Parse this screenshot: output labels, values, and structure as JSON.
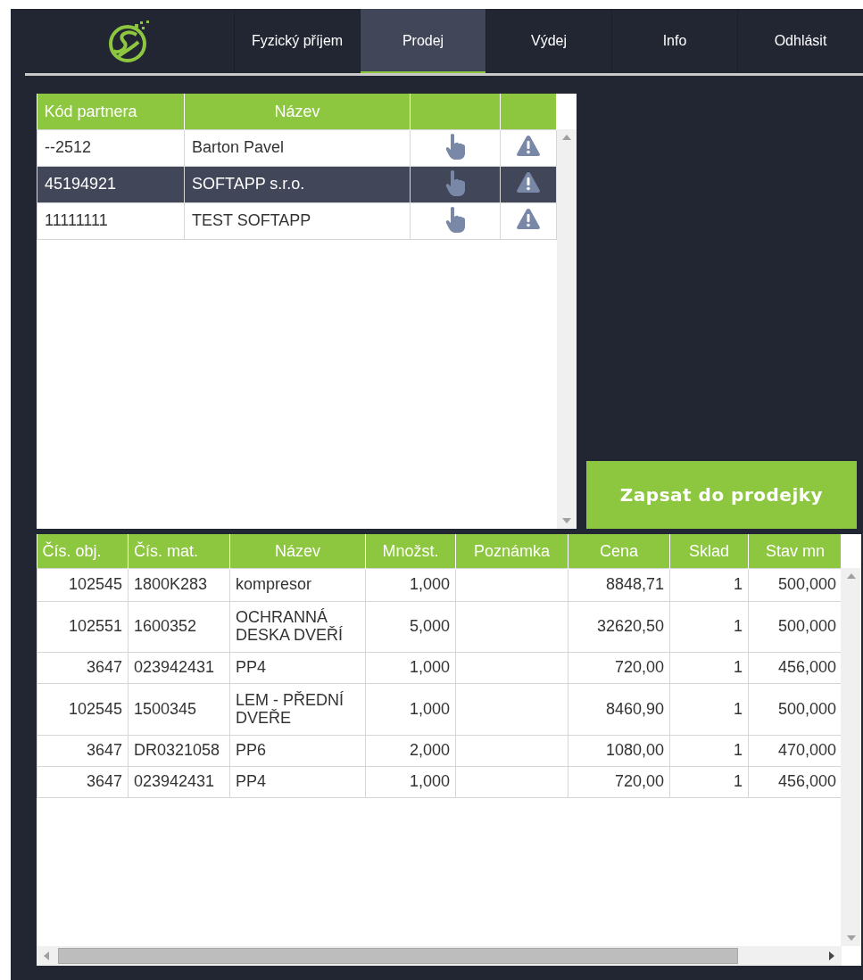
{
  "nav": {
    "tabs": [
      {
        "label": "Fyzický příjem",
        "selected": false
      },
      {
        "label": "Prodej",
        "selected": true
      },
      {
        "label": "Výdej",
        "selected": false
      },
      {
        "label": "Info",
        "selected": false
      },
      {
        "label": "Odhlásit",
        "selected": false
      }
    ]
  },
  "partners": {
    "columns": [
      "Kód partnera",
      "Název"
    ],
    "rows": [
      {
        "code": "--2512",
        "name": "Barton Pavel",
        "selected": false
      },
      {
        "code": "45194921",
        "name": "SOFTAPP s.r.o.",
        "selected": true
      },
      {
        "code": "11111111",
        "name": "TEST SOFTAPP",
        "selected": false
      }
    ]
  },
  "write_button": "Zapsat do prodejky",
  "items": {
    "columns": [
      "Čís. obj.",
      "Čís. mat.",
      "Název",
      "Množst.",
      "Poznámka",
      "Cena",
      "Sklad",
      "Stav mn"
    ],
    "rows": [
      [
        "102545",
        "1800K283",
        "kompresor",
        "1,000",
        "",
        "8848,71",
        "1",
        "500,000"
      ],
      [
        "102551",
        "1600352",
        "OCHRANNÁ DESKA DVEŘÍ",
        "5,000",
        "",
        "32620,50",
        "1",
        "500,000"
      ],
      [
        "3647",
        "023942431",
        "PP4",
        "1,000",
        "",
        "720,00",
        "1",
        "456,000"
      ],
      [
        "102545",
        "1500345",
        "LEM - PŘEDNÍ DVEŘE",
        "1,000",
        "",
        "8460,90",
        "1",
        "500,000"
      ],
      [
        "3647",
        "DR0321058",
        "PP6",
        "2,000",
        "",
        "1080,00",
        "1",
        "470,000"
      ],
      [
        "3647",
        "023942431",
        "PP4",
        "1,000",
        "",
        "720,00",
        "1",
        "456,000"
      ]
    ]
  }
}
